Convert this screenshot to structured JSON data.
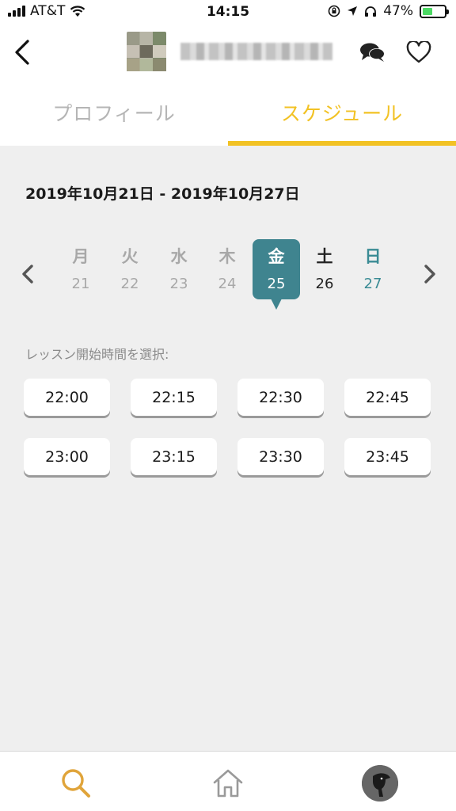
{
  "status_bar": {
    "carrier": "AT&T",
    "time": "14:15",
    "battery_percent": "47%",
    "battery_level": 0.47
  },
  "header": {
    "back_icon": "chevron-left-icon",
    "chat_icon": "chat-bubbles-icon",
    "favorite_icon": "heart-icon"
  },
  "tabs": [
    {
      "label": "プロフィール",
      "active": false
    },
    {
      "label": "スケジュール",
      "active": true
    }
  ],
  "schedule": {
    "date_range": "2019年10月21日 - 2019年10月27日",
    "days": [
      {
        "dow": "月",
        "date": "21"
      },
      {
        "dow": "火",
        "date": "22"
      },
      {
        "dow": "水",
        "date": "23"
      },
      {
        "dow": "木",
        "date": "24"
      },
      {
        "dow": "金",
        "date": "25",
        "selected": true
      },
      {
        "dow": "土",
        "date": "26"
      },
      {
        "dow": "日",
        "date": "27"
      }
    ],
    "time_label": "レッスン開始時間を選択:",
    "times": [
      "22:00",
      "22:15",
      "22:30",
      "22:45",
      "23:00",
      "23:15",
      "23:30",
      "23:45"
    ]
  },
  "colors": {
    "accent_yellow": "#f2c224",
    "selected_teal": "#3f848f",
    "sunday_teal": "#3a8b94",
    "background": "#efefef"
  },
  "bottom_nav": [
    {
      "icon": "search-icon"
    },
    {
      "icon": "home-icon"
    },
    {
      "icon": "profile-avatar-icon"
    }
  ]
}
